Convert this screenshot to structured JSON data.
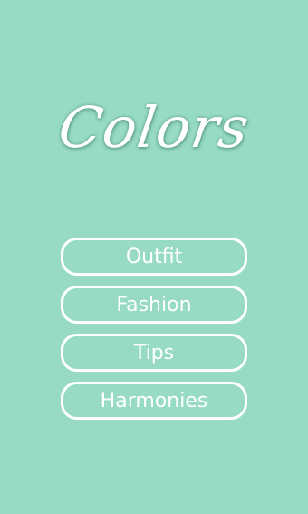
{
  "app": {
    "title": "Colors"
  },
  "menu": {
    "items": [
      {
        "label": "Outfit"
      },
      {
        "label": "Fashion"
      },
      {
        "label": "Tips"
      },
      {
        "label": "Harmonies"
      }
    ]
  },
  "theme": {
    "background": "#98dbc3",
    "foreground": "#ffffff"
  }
}
